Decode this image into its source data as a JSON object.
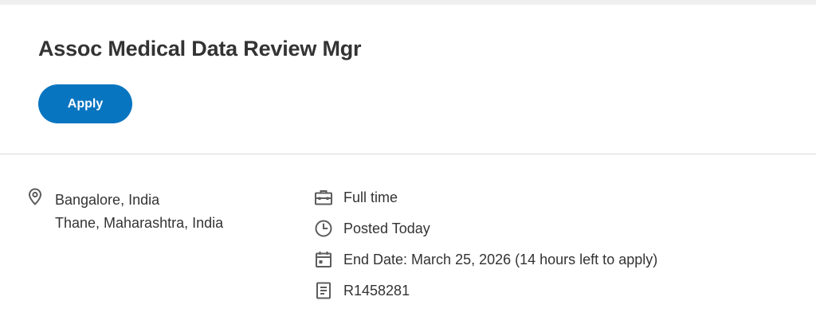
{
  "job": {
    "title": "Assoc Medical Data Review Mgr",
    "apply_label": "Apply"
  },
  "locations": [
    "Bangalore, India",
    "Thane, Maharashtra, India"
  ],
  "info": {
    "employment_type": "Full time",
    "posted": "Posted Today",
    "end_date": "End Date: March 25, 2026 (14 hours left to apply)",
    "requisition_id": "R1458281"
  },
  "icons": {
    "location": "location-pin-icon",
    "employment_type": "briefcase-icon",
    "posted": "clock-icon",
    "end_date": "calendar-icon",
    "requisition_id": "document-icon"
  },
  "colors": {
    "accent": "#0875c1",
    "icon": "#5c5c5c",
    "text": "#333333",
    "divider": "#d9d9d9"
  }
}
